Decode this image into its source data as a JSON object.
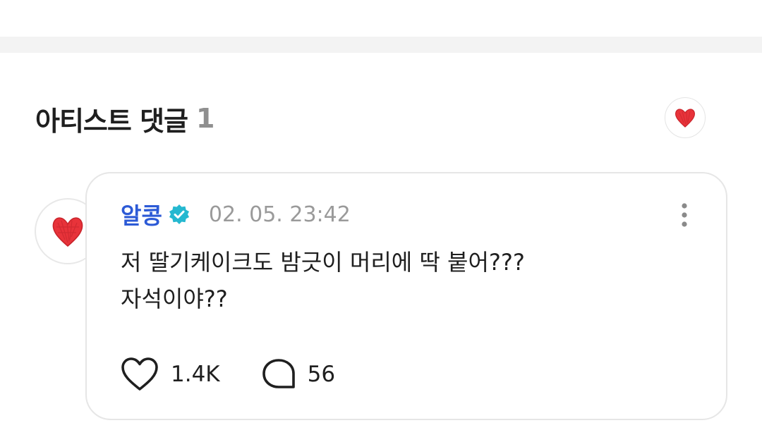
{
  "section": {
    "title": "아티스트 댓글",
    "count": "1"
  },
  "header_avatar": {
    "icon": "red-heart-icon",
    "color": "#e8333a"
  },
  "comment": {
    "author": "알콩",
    "verified_icon": "verified-badge-icon",
    "verified_color": "#25b8d0",
    "timestamp": "02. 05. 23:42",
    "body_lines": [
      "저 딸기케이크도 밤긋이 머리에 딱 붙어???",
      "자석이야??"
    ],
    "likes": "1.4K",
    "replies": "56",
    "like_icon": "heart-outline-icon",
    "reply_icon": "speech-bubble-icon",
    "more_icon": "more-vertical-icon"
  },
  "colors": {
    "accent_blue": "#2c5ad6",
    "heart_red": "#e8333a",
    "band_gray": "#f3f3f3"
  }
}
